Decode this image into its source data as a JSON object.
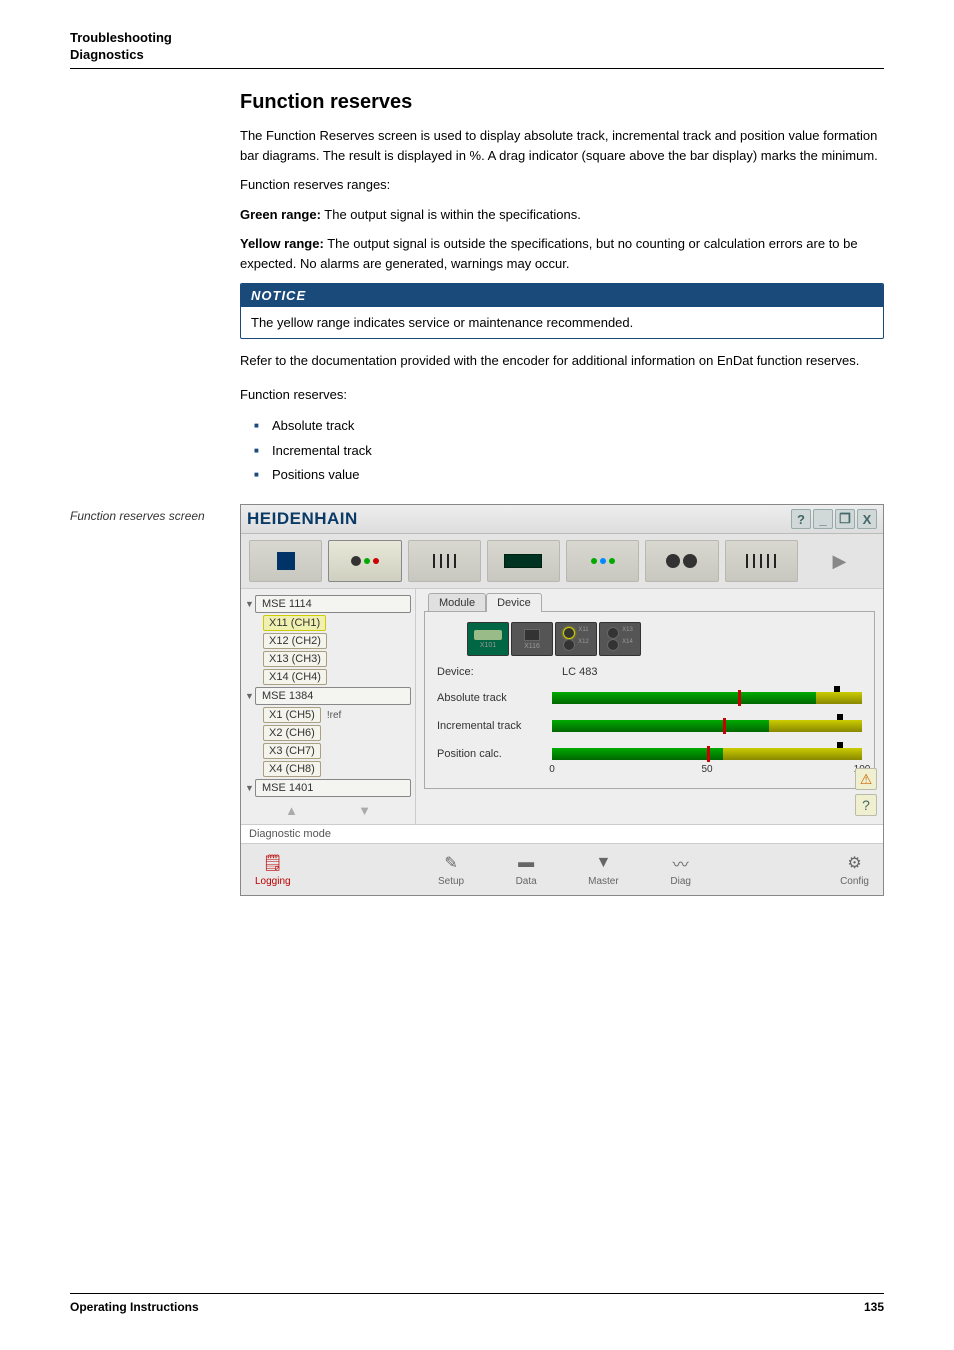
{
  "header": {
    "line1": "Troubleshooting",
    "line2": "Diagnostics"
  },
  "title": "Function reserves",
  "p1": "The Function Reserves screen is used to display absolute track, incremental track and position value formation bar diagrams. The result is displayed in %. A drag indicator (square above the bar display) marks the minimum.",
  "p2": "Function reserves ranges:",
  "green_label": "Green range:",
  "green_text": " The output signal is within the specifications.",
  "yellow_label": "Yellow range:",
  "yellow_text": " The output signal is outside the specifications, but no counting or calculation errors are to be expected. No alarms are generated, warnings may occur.",
  "notice": {
    "head": "NOTICE",
    "body": "The yellow range indicates service or maintenance recommended."
  },
  "p3": "Refer to the documentation provided with the encoder for additional information on EnDat function reserves.",
  "p4": "Function reserves:",
  "bullets": [
    "Absolute track",
    "Incremental track",
    "Positions value"
  ],
  "caption": "Function reserves screen",
  "app": {
    "brand": "HEIDENHAIN",
    "win": {
      "help": "?",
      "min": "_",
      "restore": "❐",
      "close": "X"
    },
    "tree": {
      "n1": "MSE 1114",
      "n1c": [
        "X11 (CH1)",
        "X12 (CH2)",
        "X13 (CH3)",
        "X14 (CH4)"
      ],
      "n2": "MSE 1384",
      "n2c": [
        "X1 (CH5)",
        "X2 (CH6)",
        "X3 (CH7)",
        "X4 (CH8)"
      ],
      "n2c1_suffix": "!ref",
      "n3": "MSE 1401"
    },
    "tabs": {
      "module": "Module",
      "device": "Device"
    },
    "modvis": {
      "l1": "X101",
      "l2": "X116",
      "p1": "X11",
      "p2": "X13",
      "p3": "X12",
      "p4": "X14"
    },
    "device_label": "Device:",
    "device_value": "LC 483",
    "bars": {
      "abs": {
        "label": "Absolute track",
        "green": 85,
        "marker": 91,
        "drag": 60
      },
      "inc": {
        "label": "Incremental track",
        "green": 70,
        "marker": 92,
        "drag": 55
      },
      "pos": {
        "label": "Position calc.",
        "green": 55,
        "marker": 92,
        "drag": 50
      }
    },
    "axis": {
      "t0": "0",
      "t50": "50",
      "t100": "100"
    },
    "side": {
      "warn": "⚠",
      "help": "?"
    },
    "status": "Diagnostic mode",
    "nav": {
      "logging": "Logging",
      "setup": "Setup",
      "data": "Data",
      "master": "Master",
      "diag": "Diag",
      "config": "Config"
    }
  },
  "footer": {
    "left": "Operating Instructions",
    "right": "135"
  }
}
